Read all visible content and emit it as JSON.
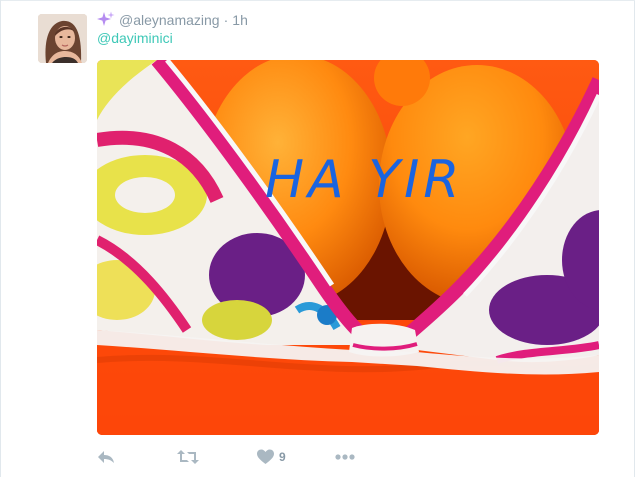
{
  "tweet": {
    "username": "@aleynamazing",
    "separator": "·",
    "timestamp": "1h",
    "reply_to": "@dayiminici",
    "image_caption": "HA YIR",
    "like_count": "9"
  },
  "icons": {
    "badge": "sparkle-icon",
    "reply": "reply-icon",
    "retweet": "retweet-icon",
    "like": "heart-icon",
    "more": "more-icon"
  },
  "colors": {
    "reply_to_link": "#3ec8b7",
    "meta_text": "#8899a6",
    "action_icon": "#aab8c2",
    "caption_ink": "#1a64e0",
    "sparkle": "#b58cf0"
  }
}
